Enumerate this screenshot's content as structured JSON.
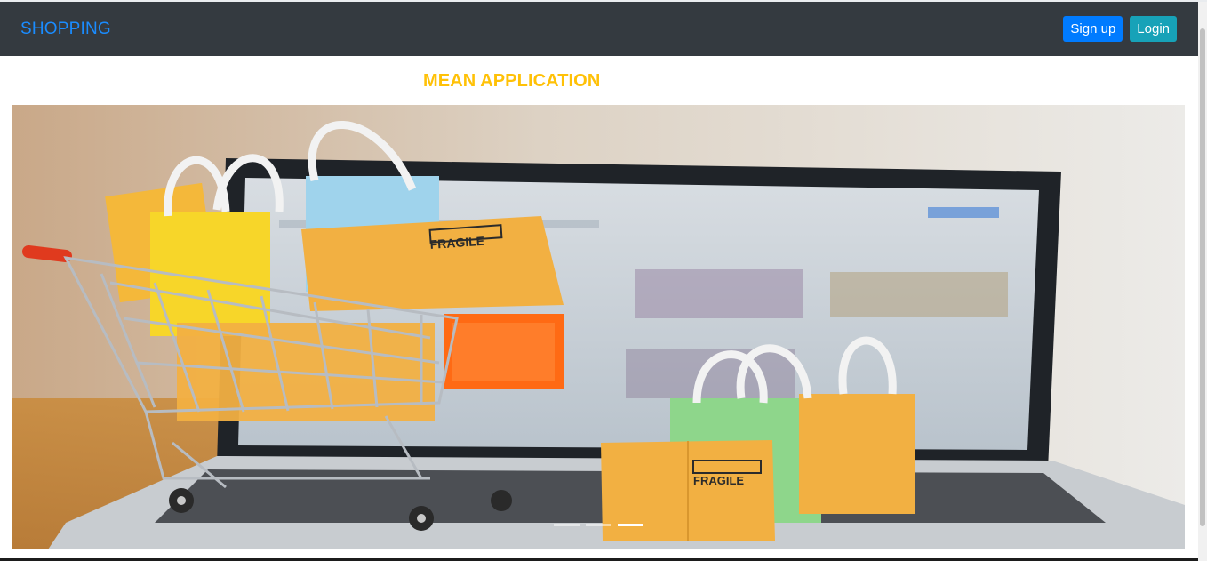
{
  "navbar": {
    "brand": "SHOPPING",
    "signup_label": "Sign up",
    "login_label": "Login"
  },
  "main": {
    "heading": "MEAN APPLICATION"
  },
  "carousel": {
    "slide_count": 3,
    "active_index": 2,
    "box_label": "FRAGILE"
  },
  "colors": {
    "navbar_bg": "#343a40",
    "brand": "#1a8cff",
    "signup_bg": "#007bff",
    "login_bg": "#17a2b8",
    "heading": "#ffc107"
  }
}
